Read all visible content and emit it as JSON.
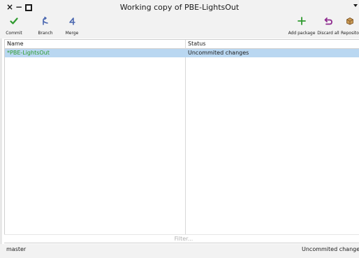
{
  "window": {
    "title": "Working copy of PBE-LightsOut",
    "controls": [
      "close-icon",
      "minimize-icon",
      "maximize-icon",
      "menu-icon"
    ]
  },
  "toolbar": {
    "commit": {
      "label": "Commit",
      "icon": "checkmark-icon",
      "color": "#2e9a2e"
    },
    "branch": {
      "label": "Branch",
      "icon": "branch-icon",
      "color": "#4a67b0"
    },
    "merge": {
      "label": "Merge",
      "icon": "merge-icon",
      "color": "#4a67b0"
    },
    "add_package": {
      "label": "Add package",
      "icon": "plus-icon",
      "color": "#2e9a2e"
    },
    "discard_all": {
      "label": "Discard all",
      "icon": "undo-icon",
      "color": "#8e2a8e"
    },
    "repositories": {
      "label": "Repositor",
      "icon": "box-icon",
      "color": "#b07a2e"
    }
  },
  "table": {
    "columns": [
      "Name",
      "Status"
    ],
    "rows": [
      {
        "name": "*PBE-LightsOut",
        "status": "Uncommited changes",
        "selected": true
      }
    ],
    "selection_color": "#b9d7f1",
    "name_color": "#2e9a2e"
  },
  "filter": {
    "placeholder": "Filter...",
    "value": ""
  },
  "statusbar": {
    "branch": "master",
    "state": "Uncommited change"
  }
}
